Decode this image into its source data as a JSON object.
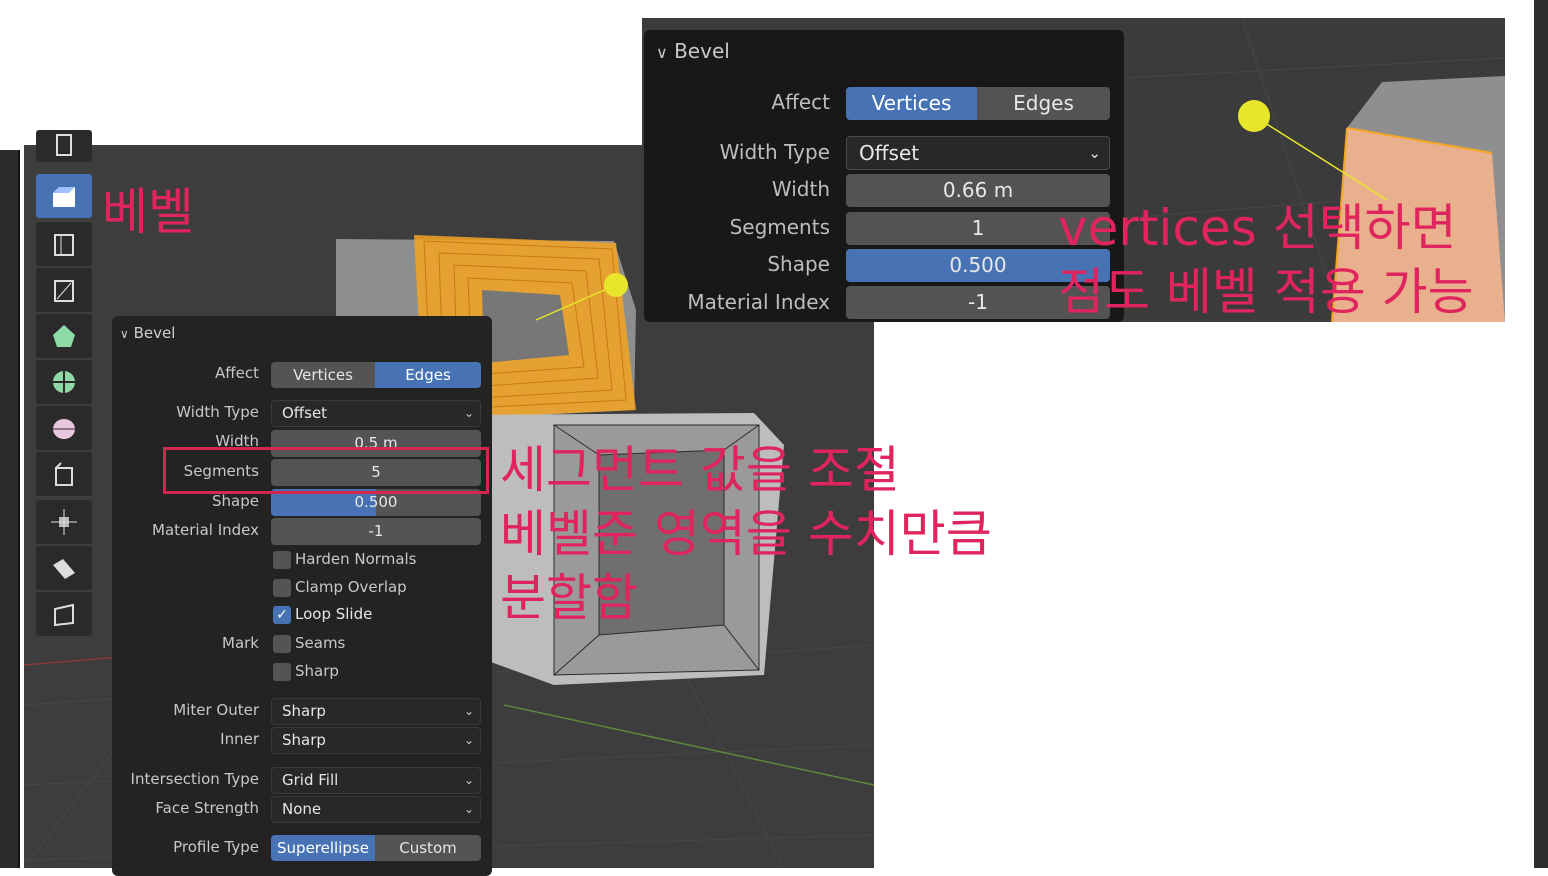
{
  "annotations": {
    "bevel_tool": "베벨",
    "segments_line1": "세그먼트 값을 조절",
    "segments_line2": "베벨준 영역을 수치만큼",
    "segments_line3": "분할함",
    "vertices_line1": "vertices 선택하면",
    "vertices_line2": "점도 베벨 적용 가능"
  },
  "left_panel": {
    "title": "Bevel",
    "affect_label": "Affect",
    "affect_options": [
      "Vertices",
      "Edges"
    ],
    "affect_selected": "Edges",
    "width_type_label": "Width Type",
    "width_type_value": "Offset",
    "width_label": "Width",
    "width_value": "0.5 m",
    "segments_label": "Segments",
    "segments_value": "5",
    "shape_label": "Shape",
    "shape_value": "0.500",
    "shape_fill": 0.5,
    "material_index_label": "Material Index",
    "material_index_value": "-1",
    "harden_normals": "Harden Normals",
    "clamp_overlap": "Clamp Overlap",
    "loop_slide": "Loop Slide",
    "mark_label": "Mark",
    "seams": "Seams",
    "sharp": "Sharp",
    "miter_outer_label": "Miter Outer",
    "miter_outer_value": "Sharp",
    "inner_label": "Inner",
    "inner_value": "Sharp",
    "intersection_type_label": "Intersection Type",
    "intersection_type_value": "Grid Fill",
    "face_strength_label": "Face Strength",
    "face_strength_value": "None",
    "profile_type_label": "Profile Type",
    "profile_options": [
      "Superellipse",
      "Custom"
    ],
    "profile_selected": "Superellipse"
  },
  "right_panel": {
    "title": "Bevel",
    "affect_label": "Affect",
    "affect_options": [
      "Vertices",
      "Edges"
    ],
    "affect_selected": "Vertices",
    "width_type_label": "Width Type",
    "width_type_value": "Offset",
    "width_label": "Width",
    "width_value": "0.66 m",
    "segments_label": "Segments",
    "segments_value": "1",
    "shape_label": "Shape",
    "shape_value": "0.500",
    "shape_fill": 1.0,
    "material_index_label": "Material Index",
    "material_index_value": "-1"
  },
  "colors": {
    "accent_blue": "#4772b3",
    "annotation_red": "#e0245e",
    "selection_orange": "#f5a623",
    "gizmo_yellow": "#e8e62a"
  },
  "icons": [
    "bevel-tool-icon",
    "extrude-icon",
    "inset-icon",
    "loop-cut-icon",
    "knife-icon",
    "poly-build-icon",
    "spin-icon",
    "smooth-icon",
    "edge-slide-icon",
    "shrink-fatten-icon",
    "shear-icon",
    "rip-icon"
  ]
}
